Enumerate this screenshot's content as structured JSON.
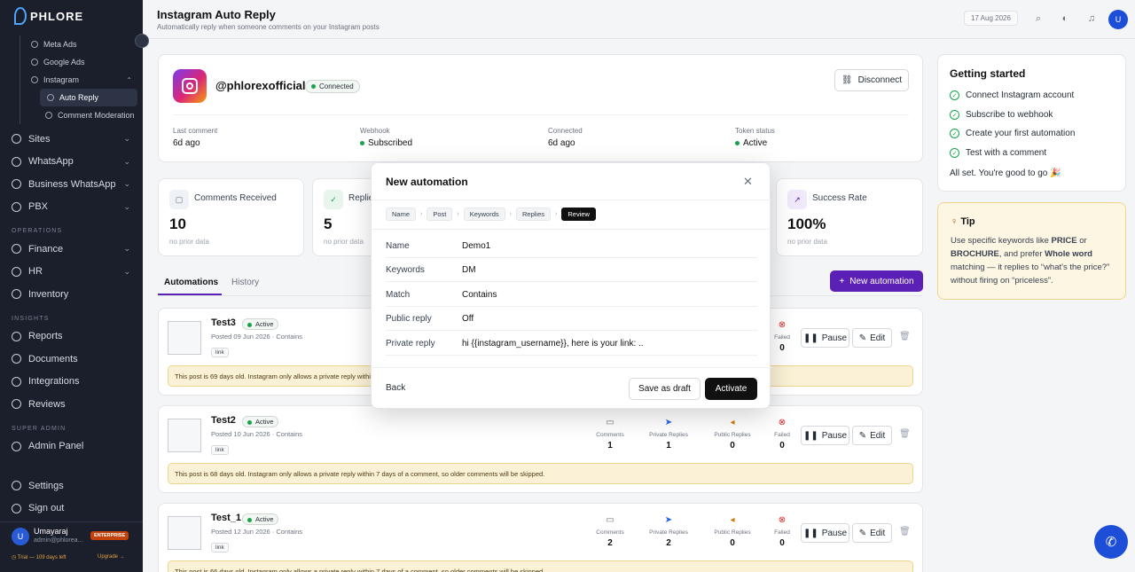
{
  "sidebar": {
    "brand": "PHLORE",
    "sub_items": [
      "Meta Ads",
      "Google Ads",
      "Instagram",
      "Auto Reply",
      "Comment Moderation"
    ],
    "nav_top": [
      "Sites",
      "WhatsApp",
      "Business WhatsApp",
      "PBX"
    ],
    "section_operations": "OPERATIONS",
    "nav_ops": [
      "Finance",
      "HR",
      "Inventory"
    ],
    "section_insights": "INSIGHTS",
    "nav_insights": [
      "Reports",
      "Documents",
      "Integrations",
      "Reviews"
    ],
    "section_admin": "SUPER ADMIN",
    "nav_admin": [
      "Admin Panel"
    ],
    "nav_bottom": [
      "Settings",
      "Sign out"
    ],
    "user": {
      "initial": "U",
      "name": "Umayaraj",
      "email": "admin@phlorea...",
      "plan": "ENTERPRISE",
      "trial": "◷ Trial — 109 days left",
      "upgrade": "Upgrade →"
    }
  },
  "header": {
    "title": "Instagram Auto Reply",
    "subtitle": "Automatically reply when someone comments on your Instagram posts",
    "date": "17 Aug 2026",
    "avatar": "U"
  },
  "account": {
    "handle": "@phlorexofficial",
    "status": "Connected",
    "disconnect": "Disconnect",
    "stats": [
      {
        "label": "Last comment",
        "value": "6d ago"
      },
      {
        "label": "Webhook",
        "value": "Subscribed"
      },
      {
        "label": "Connected",
        "value": "6d ago"
      },
      {
        "label": "Token status",
        "value": "Active"
      }
    ]
  },
  "getting_started": {
    "title": "Getting started",
    "items": [
      "Connect Instagram account",
      "Subscribe to webhook",
      "Create your first automation",
      "Test with a comment"
    ],
    "done": "All set. You're good to go 🎉"
  },
  "tip": {
    "title": "Tip",
    "p1": "Use specific keywords like ",
    "b1": "PRICE",
    "p2": " or ",
    "b2": "BROCHURE",
    "p3": ", and prefer ",
    "b3": "Whole word",
    "p4": " matching — it replies to “what's the price?” without firing on “priceless”."
  },
  "metrics": [
    {
      "label": "Comments Received",
      "value": "10",
      "sub": "no prior data"
    },
    {
      "label": "Replies",
      "value": "5",
      "sub": "no prior data"
    },
    {
      "label": "Success Rate",
      "value": "100%",
      "sub": "no prior data"
    }
  ],
  "tabs": [
    "Automations",
    "History"
  ],
  "new_automation": "New automation",
  "metric_labels": {
    "comments": "Comments",
    "private": "Private Replies",
    "public": "Public Replies",
    "failed": "Failed"
  },
  "buttons": {
    "pause": "Pause",
    "edit": "Edit"
  },
  "automations": [
    {
      "name": "Test3",
      "status": "Active",
      "posted": "Posted 09 Jun 2026 · Contains",
      "link": "link",
      "warning": "This post is 69 days old. Instagram only allows a private reply within 7 days of a comment, so older comments will be skipped.",
      "comments": "",
      "private": "",
      "public": "",
      "failed": "0"
    },
    {
      "name": "Test2",
      "status": "Active",
      "posted": "Posted 10 Jun 2026 · Contains",
      "link": "link",
      "warning": "This post is 68 days old. Instagram only allows a private reply within 7 days of a comment, so older comments will be skipped.",
      "comments": "1",
      "private": "1",
      "public": "0",
      "failed": "0"
    },
    {
      "name": "Test_1",
      "status": "Active",
      "posted": "Posted 12 Jun 2026 · Contains",
      "link": "link",
      "warning": "This post is 66 days old. Instagram only allows a private reply within 7 days of a comment, so older comments will be skipped.",
      "comments": "2",
      "private": "2",
      "public": "0",
      "failed": "0"
    }
  ],
  "modal": {
    "title": "New automation",
    "steps": [
      "Name",
      "Post",
      "Keywords",
      "Replies",
      "Review"
    ],
    "rows": [
      {
        "k": "Name",
        "v": "Demo1"
      },
      {
        "k": "Keywords",
        "v": "DM"
      },
      {
        "k": "Match",
        "v": "Contains"
      },
      {
        "k": "Public reply",
        "v": "Off"
      },
      {
        "k": "Private reply",
        "v": "hi {{instagram_username}}, here is your link: .."
      }
    ],
    "back": "Back",
    "draft": "Save as draft",
    "activate": "Activate"
  },
  "colors": {
    "accent": "#5b21b6",
    "success": "#16a34a",
    "sidebar": "#1b1f2b",
    "warning_bg": "#fbf1d6"
  }
}
